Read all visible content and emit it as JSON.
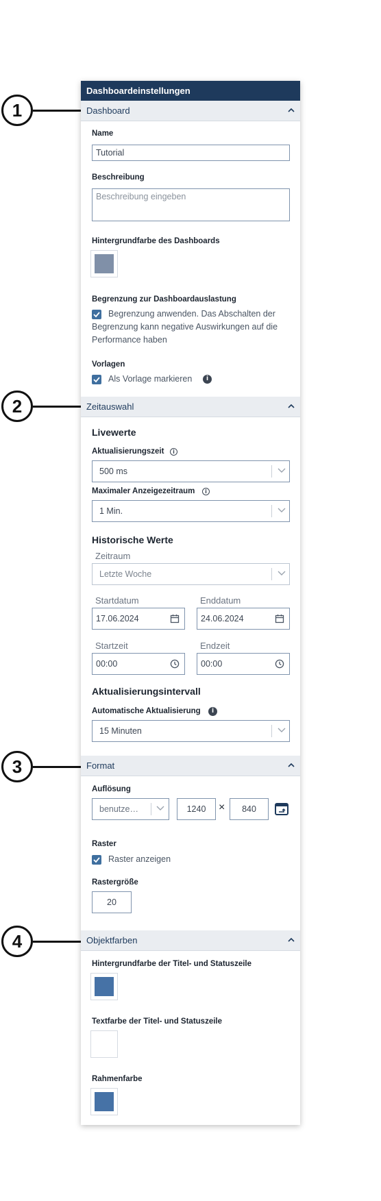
{
  "panel_title": "Dashboardeinstellungen",
  "callouts": [
    "1",
    "2",
    "3",
    "4"
  ],
  "sections": {
    "dashboard": {
      "title": "Dashboard",
      "name_label": "Name",
      "name_value": "Tutorial",
      "description_label": "Beschreibung",
      "description_placeholder": "Beschreibung eingeben",
      "bg_color_label": "Hintergrundfarbe des Dashboards",
      "bg_color": "#8090a8",
      "limit_label": "Begrenzung zur Dashboardauslastung",
      "limit_checkbox_text": "Begrenzung anwenden. Das Abschalten der Begrenzung kann negative Auswirkungen auf die Performance haben",
      "templates_label": "Vorlagen",
      "template_checkbox_text": "Als Vorlage markieren"
    },
    "time": {
      "title": "Zeitauswahl",
      "live_heading": "Livewerte",
      "update_time_label": "Aktualisierungszeit",
      "update_time_value": "500 ms",
      "max_range_label": "Maximaler Anzeigezeitraum",
      "max_range_value": "1 Min.",
      "historic_heading": "Historische Werte",
      "period_label": "Zeitraum",
      "period_value": "Letzte Woche",
      "start_date_label": "Startdatum",
      "start_date_value": "17.06.2024",
      "end_date_label": "Enddatum",
      "end_date_value": "24.06.2024",
      "start_time_label": "Startzeit",
      "start_time_value": "00:00",
      "end_time_label": "Endzeit",
      "end_time_value": "00:00",
      "interval_heading": "Aktualisierungsintervall",
      "auto_update_label": "Automatische Aktualisierung",
      "auto_update_value": "15 Minuten"
    },
    "format": {
      "title": "Format",
      "resolution_label": "Auflösung",
      "resolution_mode": "benutze…",
      "width_value": "1240",
      "times_sign": "×",
      "height_value": "840",
      "grid_label": "Raster",
      "grid_checkbox_text": "Raster anzeigen",
      "grid_size_label": "Rastergröße",
      "grid_size_value": "20"
    },
    "object_colors": {
      "title": "Objektfarben",
      "title_bar_bg_label": "Hintergrundfarbe der Titel- und Statuszeile",
      "title_bar_bg_color": "#4672a6",
      "title_bar_text_label": "Textfarbe der Titel- und Statuszeile",
      "title_bar_text_color": "#ffffff",
      "border_color_label": "Rahmenfarbe",
      "border_color": "#4672a6"
    }
  },
  "icons": {
    "collapse": "chevron-up-icon",
    "dropdown": "chevron-down-icon",
    "date": "calendar-icon",
    "time": "clock-icon",
    "info": "info-icon",
    "check": "checkmark-icon",
    "resolution": "screen-resize-icon"
  }
}
